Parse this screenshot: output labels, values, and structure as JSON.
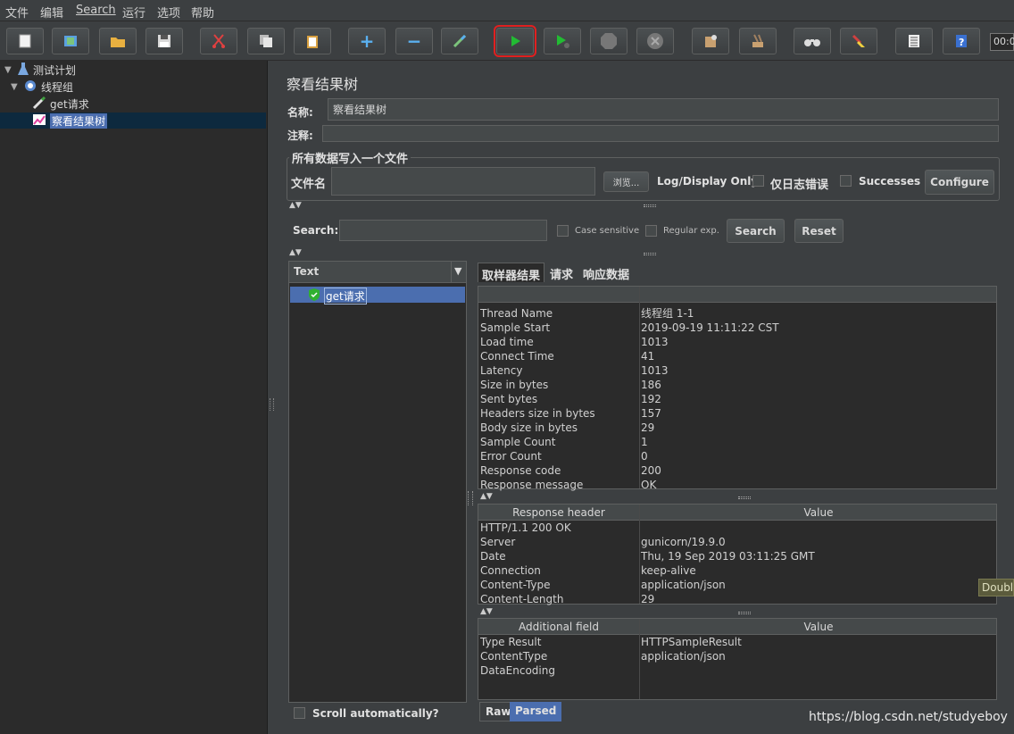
{
  "menu": [
    "文件",
    "编辑",
    "Search",
    "运行",
    "选项",
    "帮助"
  ],
  "toolbar": {
    "buttons": [
      "new",
      "templates",
      "open",
      "save",
      "cut",
      "copy",
      "paste",
      "expand",
      "collapse",
      "toggle",
      "start",
      "start-no-pause",
      "stop",
      "shutdown",
      "clear",
      "clear-all",
      "search",
      "reset-search",
      "function-helper",
      "help"
    ],
    "timer": "00:0"
  },
  "tree": {
    "nodes": [
      {
        "label": "测试计划",
        "icon": "flask-icon"
      },
      {
        "label": "线程组",
        "icon": "gear-icon"
      },
      {
        "label": "get请求",
        "icon": "pipette-icon"
      },
      {
        "label": "察看结果树",
        "icon": "chart-icon"
      }
    ]
  },
  "panel": {
    "title": "察看结果树",
    "name_label": "名称:",
    "name_value": "察看结果树",
    "comment_label": "注释:",
    "comment_value": "",
    "file_group_title": "所有数据写入一个文件",
    "file_label": "文件名",
    "file_value": "",
    "browse_label": "浏览...",
    "log_display_label": "Log/Display Only:",
    "errors_only_label": "仅日志错误",
    "successes_label": "Successes",
    "configure_label": "Configure",
    "search_label": "Search:",
    "search_value": "",
    "case_sensitive_label": "Case sensitive",
    "regex_label": "Regular exp.",
    "search_button": "Search",
    "reset_button": "Reset",
    "render_mode": "Text",
    "results": [
      {
        "label": "get请求",
        "status": "success"
      }
    ],
    "scroll_auto_label": "Scroll automatically?",
    "tabs": [
      "取样器结果",
      "请求",
      "响应数据"
    ],
    "bottom_tabs": [
      "Raw",
      "Parsed"
    ],
    "tooltip": "Double"
  },
  "sampler": {
    "rows": [
      [
        "Thread Name",
        "线程组 1-1"
      ],
      [
        "Sample Start",
        "2019-09-19 11:11:22 CST"
      ],
      [
        "Load time",
        "1013"
      ],
      [
        "Connect Time",
        "41"
      ],
      [
        "Latency",
        "1013"
      ],
      [
        "Size in bytes",
        "186"
      ],
      [
        "Sent bytes",
        "192"
      ],
      [
        "Headers size in bytes",
        "157"
      ],
      [
        "Body size in bytes",
        "29"
      ],
      [
        "Sample Count",
        "1"
      ],
      [
        "Error Count",
        "0"
      ],
      [
        "Response code",
        "200"
      ],
      [
        "Response message",
        "OK"
      ]
    ]
  },
  "headers": {
    "col1": "Response header",
    "col2": "Value",
    "rows": [
      [
        "HTTP/1.1 200 OK",
        ""
      ],
      [
        "Server",
        "gunicorn/19.9.0"
      ],
      [
        "Date",
        "Thu, 19 Sep 2019 03:11:25 GMT"
      ],
      [
        "Connection",
        "keep-alive"
      ],
      [
        "Content-Type",
        "application/json"
      ],
      [
        "Content-Length",
        "29"
      ]
    ]
  },
  "additional": {
    "col1": "Additional field",
    "col2": "Value",
    "rows": [
      [
        "Type Result",
        "HTTPSampleResult"
      ],
      [
        "ContentType",
        "application/json"
      ],
      [
        "DataEncoding",
        ""
      ]
    ]
  },
  "watermark": "https://blog.csdn.net/studyeboy"
}
